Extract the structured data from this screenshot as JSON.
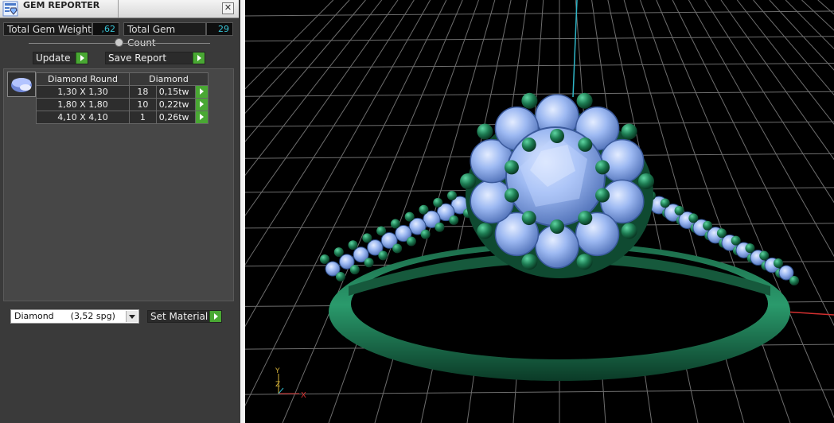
{
  "window": {
    "title": "GEM REPORTER",
    "close_label": "✕"
  },
  "summary": {
    "total_weight_label": "Total Gem Weight",
    "total_weight_value": ",62",
    "total_count_label": "Total Gem Count",
    "total_count_value": "29",
    "slider_position_pct": 50
  },
  "toolbar": {
    "update_label": "Update",
    "save_label": "Save Report"
  },
  "gem_table": {
    "headers": [
      "Diamond Round",
      "Diamond"
    ],
    "rows": [
      {
        "size": "1,30 X 1,30",
        "count": "18",
        "weight": "0,15tw"
      },
      {
        "size": "1,80 X 1,80",
        "count": "10",
        "weight": "0,22tw"
      },
      {
        "size": "4,10 X 4,10",
        "count": "1",
        "weight": "0,26tw"
      }
    ]
  },
  "material": {
    "selected": "Diamond      (3,52 spg)",
    "set_label": "Set Material"
  },
  "viewport": {
    "axis_labels": {
      "x": "X",
      "y": "Y",
      "z": "Z"
    },
    "colors": {
      "metal": "#1f7a55",
      "gem": "#8fb4f0",
      "grid": "#7a7a7a",
      "axis_x": "#d43030",
      "axis_z": "#2fb6c8"
    }
  }
}
